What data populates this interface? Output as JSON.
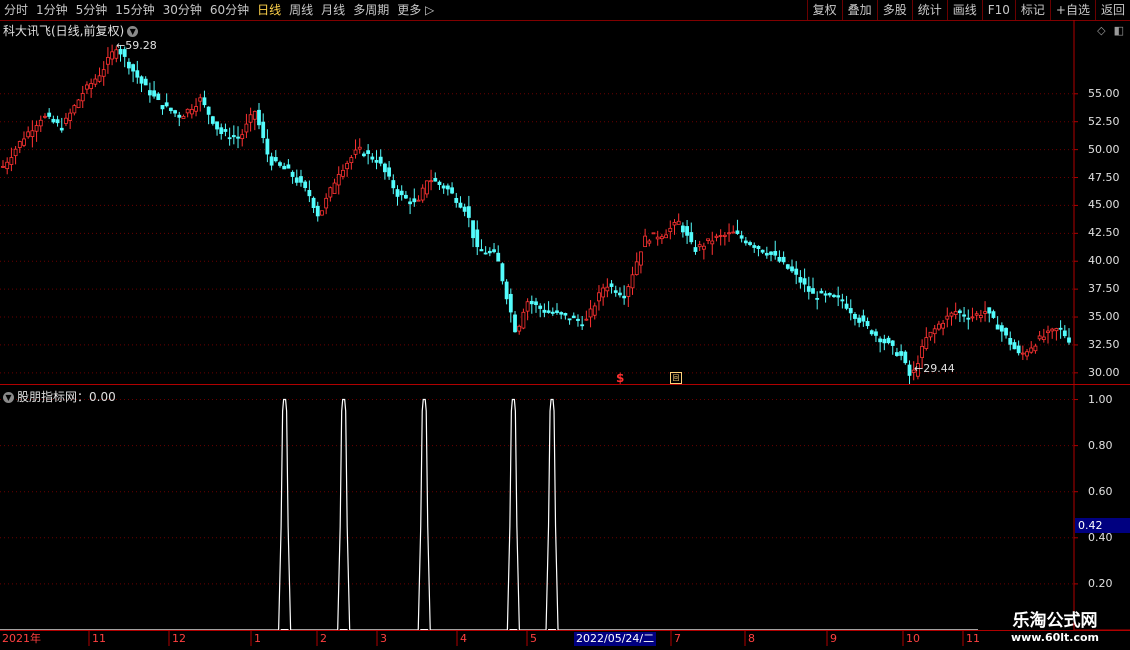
{
  "toolbar": {
    "periods": [
      "分时",
      "1分钟",
      "5分钟",
      "15分钟",
      "30分钟",
      "60分钟",
      "日线",
      "周线",
      "月线",
      "多周期",
      "更多"
    ],
    "active_period": "日线",
    "more_arrow": "▷",
    "tools": [
      "复权",
      "叠加",
      "多股",
      "统计",
      "画线",
      "F10",
      "标记",
      "+自选",
      "返回"
    ]
  },
  "chart_title": "科大讯飞(日线,前复权)",
  "title_icon": "chevron-down-icon",
  "corner_icons": [
    "diamond-icon",
    "panel-toggle-icon"
  ],
  "price": {
    "high_label": "59.28",
    "low_label": "29.44",
    "y_ticks": [
      "55.00",
      "52.50",
      "50.00",
      "47.50",
      "45.00",
      "42.50",
      "40.00",
      "37.50",
      "35.00",
      "32.50",
      "30.00"
    ],
    "up_color": "#ff3232",
    "down_color": "#54fcfc"
  },
  "markers": {
    "s": "$",
    "box": "回"
  },
  "indicator": {
    "title": "股朋指标网：0.00",
    "y_ticks": [
      "1.00",
      "0.80",
      "0.60",
      "0.40",
      "0.20"
    ],
    "current_value": "0.42",
    "line_color": "#ffffff"
  },
  "date_axis": {
    "labels": [
      "2021年",
      "11",
      "12",
      "1",
      "2",
      "3",
      "4",
      "5",
      "7",
      "8",
      "9",
      "10",
      "11"
    ],
    "cursor_date": "2022/05/24/二"
  },
  "watermark": {
    "line1": "乐淘公式网",
    "line2": "www.60lt.com"
  },
  "chart_data": [
    {
      "type": "candlestick",
      "title": "科大讯飞(日线,前复权)",
      "x_range": [
        "2021-10",
        "2022-11"
      ],
      "ylim": [
        29.0,
        60.0
      ],
      "grid": true,
      "anchors": [
        {
          "t": 0,
          "v": 48.5
        },
        {
          "t": 0.02,
          "v": 51
        },
        {
          "t": 0.04,
          "v": 53
        },
        {
          "t": 0.06,
          "v": 52
        },
        {
          "t": 0.08,
          "v": 55
        },
        {
          "t": 0.1,
          "v": 57
        },
        {
          "t": 0.115,
          "v": 59.28
        },
        {
          "t": 0.14,
          "v": 56
        },
        {
          "t": 0.16,
          "v": 54
        },
        {
          "t": 0.18,
          "v": 53
        },
        {
          "t": 0.2,
          "v": 54.5
        },
        {
          "t": 0.22,
          "v": 51.5
        },
        {
          "t": 0.24,
          "v": 51
        },
        {
          "t": 0.255,
          "v": 53.5
        },
        {
          "t": 0.27,
          "v": 49
        },
        {
          "t": 0.29,
          "v": 48
        },
        {
          "t": 0.31,
          "v": 46
        },
        {
          "t": 0.32,
          "v": 44
        },
        {
          "t": 0.34,
          "v": 48
        },
        {
          "t": 0.36,
          "v": 50
        },
        {
          "t": 0.38,
          "v": 49
        },
        {
          "t": 0.4,
          "v": 46
        },
        {
          "t": 0.42,
          "v": 45
        },
        {
          "t": 0.43,
          "v": 47.5
        },
        {
          "t": 0.45,
          "v": 46.5
        },
        {
          "t": 0.47,
          "v": 44.5
        },
        {
          "t": 0.48,
          "v": 41
        },
        {
          "t": 0.5,
          "v": 40.5
        },
        {
          "t": 0.51,
          "v": 37
        },
        {
          "t": 0.52,
          "v": 33.5
        },
        {
          "t": 0.53,
          "v": 36.5
        },
        {
          "t": 0.55,
          "v": 35.5
        },
        {
          "t": 0.57,
          "v": 35
        },
        {
          "t": 0.59,
          "v": 34.5
        },
        {
          "t": 0.61,
          "v": 38
        },
        {
          "t": 0.63,
          "v": 37
        },
        {
          "t": 0.65,
          "v": 42
        },
        {
          "t": 0.67,
          "v": 42.5
        },
        {
          "t": 0.685,
          "v": 43.5
        },
        {
          "t": 0.7,
          "v": 41
        },
        {
          "t": 0.72,
          "v": 42
        },
        {
          "t": 0.74,
          "v": 42.5
        },
        {
          "t": 0.76,
          "v": 41.5
        },
        {
          "t": 0.78,
          "v": 40.5
        },
        {
          "t": 0.8,
          "v": 39
        },
        {
          "t": 0.82,
          "v": 37
        },
        {
          "t": 0.85,
          "v": 36.5
        },
        {
          "t": 0.87,
          "v": 34.5
        },
        {
          "t": 0.89,
          "v": 33
        },
        {
          "t": 0.91,
          "v": 31.5
        },
        {
          "t": 0.92,
          "v": 29.44
        },
        {
          "t": 0.935,
          "v": 33
        },
        {
          "t": 0.95,
          "v": 34.5
        },
        {
          "t": 0.965,
          "v": 35.5
        },
        {
          "t": 0.98,
          "v": 35
        },
        {
          "t": 0.995,
          "v": 35.5
        },
        {
          "t": 1.01,
          "v": 34
        },
        {
          "t": 1.03,
          "v": 31.5
        },
        {
          "t": 1.05,
          "v": 33
        },
        {
          "t": 1.07,
          "v": 34
        },
        {
          "t": 1.08,
          "v": 33
        }
      ]
    },
    {
      "type": "line",
      "title": "股朋指标网",
      "ylim": [
        0.0,
        1.05
      ],
      "grid": true,
      "pulses": [
        0.265,
        0.32,
        0.395,
        0.478,
        0.514
      ],
      "pulse_value": 1.0
    }
  ]
}
